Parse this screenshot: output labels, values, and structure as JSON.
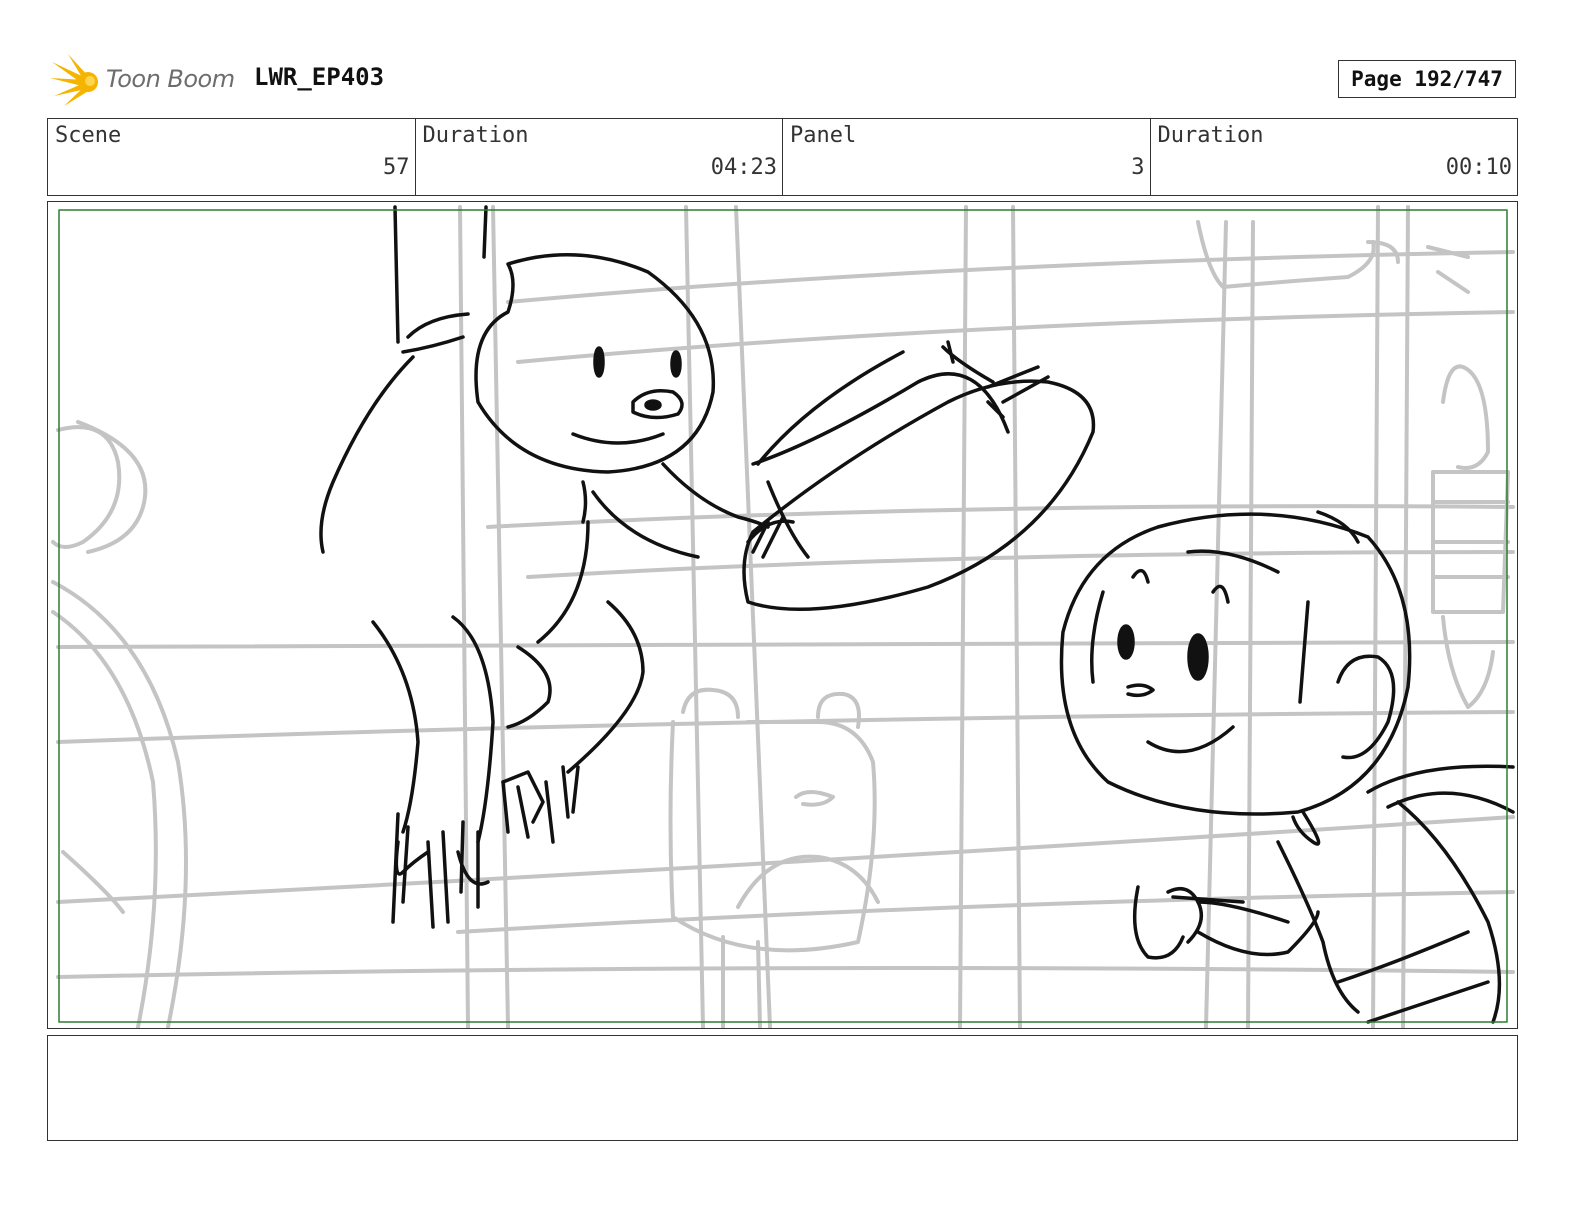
{
  "header": {
    "logo_text": "Toon Boom",
    "project_name": "LWR_EP403",
    "page_label": "Page 192/747"
  },
  "info": {
    "scene_label": "Scene",
    "scene_value": "57",
    "scene_duration_label": "Duration",
    "scene_duration_value": "04:23",
    "panel_label": "Panel",
    "panel_value": "3",
    "panel_duration_label": "Duration",
    "panel_duration_value": "00:10"
  },
  "panel": {
    "safe_frame_color": "#2e7d32",
    "ink_color": "#111111",
    "construction_color": "#c2c2c2",
    "sketch_subjects": [
      "sloth-character",
      "hat",
      "boy-character",
      "backpack",
      "cage-bars"
    ]
  },
  "caption": {
    "text": ""
  },
  "colors": {
    "logo_accent": "#f5b400",
    "border": "#333333"
  }
}
